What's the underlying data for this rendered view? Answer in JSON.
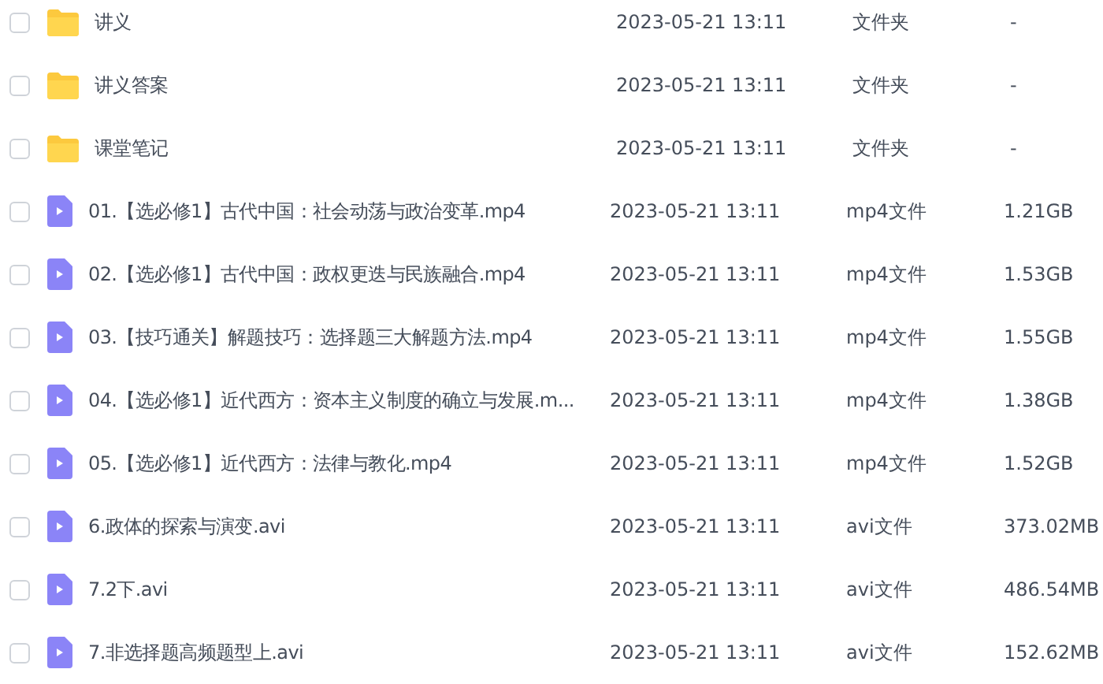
{
  "files": [
    {
      "kind": "folder",
      "name": "讲义",
      "modified": "2023-05-21 13:11",
      "type": "文件夹",
      "size": "-",
      "checked": false
    },
    {
      "kind": "folder",
      "name": "讲义答案",
      "modified": "2023-05-21 13:11",
      "type": "文件夹",
      "size": "-",
      "checked": false
    },
    {
      "kind": "folder",
      "name": "课堂笔记",
      "modified": "2023-05-21 13:11",
      "type": "文件夹",
      "size": "-",
      "checked": false
    },
    {
      "kind": "video",
      "name": "01.【选必修1】古代中国：社会动荡与政治变革.mp4",
      "modified": "2023-05-21 13:11",
      "type": "mp4文件",
      "size": "1.21GB",
      "checked": false
    },
    {
      "kind": "video",
      "name": "02.【选必修1】古代中国：政权更迭与民族融合.mp4",
      "modified": "2023-05-21 13:11",
      "type": "mp4文件",
      "size": "1.53GB",
      "checked": false
    },
    {
      "kind": "video",
      "name": "03.【技巧通关】解题技巧：选择题三大解题方法.mp4",
      "modified": "2023-05-21 13:11",
      "type": "mp4文件",
      "size": "1.55GB",
      "checked": false
    },
    {
      "kind": "video",
      "name": "04.【选必修1】近代西方：资本主义制度的确立与发展.m...",
      "modified": "2023-05-21 13:11",
      "type": "mp4文件",
      "size": "1.38GB",
      "checked": false
    },
    {
      "kind": "video",
      "name": "05.【选必修1】近代西方：法律与教化.mp4",
      "modified": "2023-05-21 13:11",
      "type": "mp4文件",
      "size": "1.52GB",
      "checked": false
    },
    {
      "kind": "video",
      "name": "6.政体的探索与演变.avi",
      "modified": "2023-05-21 13:11",
      "type": "avi文件",
      "size": "373.02MB",
      "checked": false
    },
    {
      "kind": "video",
      "name": "7.2下.avi",
      "modified": "2023-05-21 13:11",
      "type": "avi文件",
      "size": "486.54MB",
      "checked": false
    },
    {
      "kind": "video",
      "name": "7.非选择题高频题型上.avi",
      "modified": "2023-05-21 13:11",
      "type": "avi文件",
      "size": "152.62MB",
      "checked": false
    }
  ]
}
